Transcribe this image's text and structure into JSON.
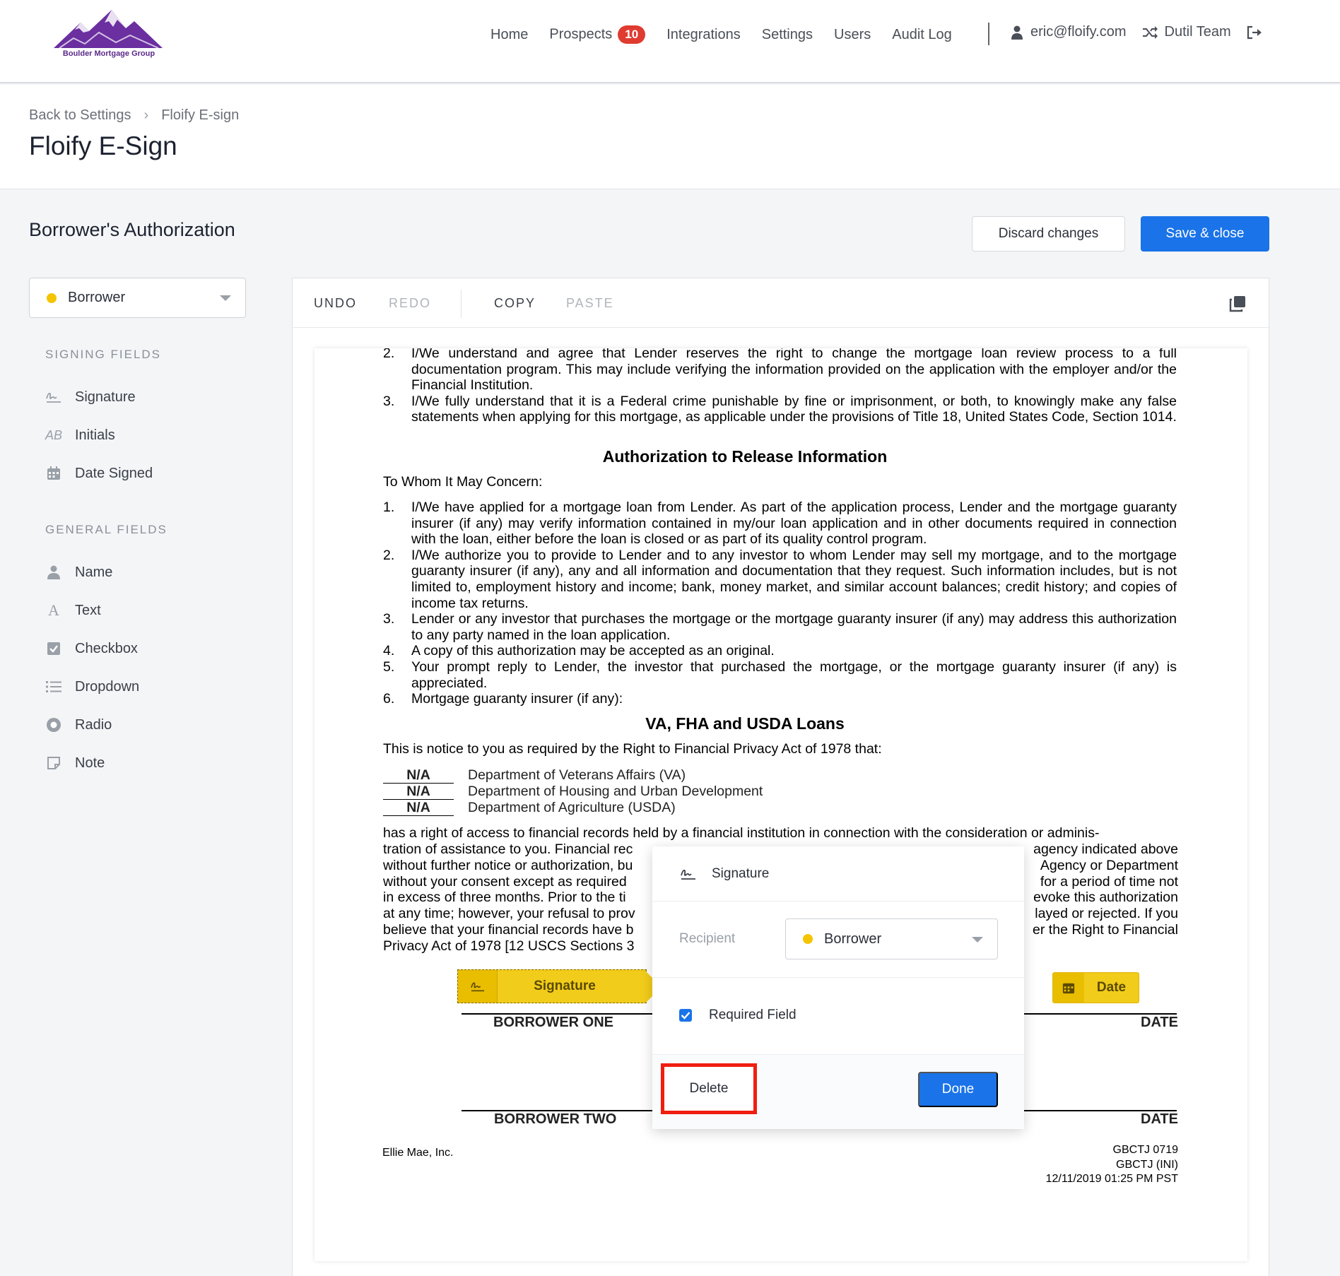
{
  "brand": {
    "logo_text": "Boulder Mortgage Group",
    "logo_color": "#6b2fa0"
  },
  "nav": {
    "home": "Home",
    "prospects": "Prospects",
    "prospects_badge": "10",
    "integrations": "Integrations",
    "settings": "Settings",
    "users": "Users",
    "audit_log": "Audit Log",
    "user_email": "eric@floify.com",
    "team": "Dutil Team"
  },
  "breadcrumb": {
    "back": "Back to Settings",
    "current": "Floify E-sign"
  },
  "page_title": "Floify E-Sign",
  "section": {
    "title": "Borrower's Authorization",
    "discard_label": "Discard changes",
    "save_label": "Save & close"
  },
  "left_panel": {
    "recipient": "Borrower",
    "recipient_color": "#f5c400",
    "signing_fields_label": "SIGNING FIELDS",
    "signing_fields": [
      "Signature",
      "Initials",
      "Date Signed"
    ],
    "general_fields_label": "GENERAL FIELDS",
    "general_fields": [
      "Name",
      "Text",
      "Checkbox",
      "Dropdown",
      "Radio",
      "Note"
    ]
  },
  "toolbar": {
    "undo": "UNDO",
    "redo": "REDO",
    "copy": "COPY",
    "paste": "PASTE"
  },
  "document": {
    "top_items": [
      {
        "num": "2.",
        "text": "I/We understand and agree that Lender reserves the right to change the mortgage loan review process to a full documentation program. This may include verifying the information provided on the application with the employer and/or the Financial Institution."
      },
      {
        "num": "3.",
        "text": "I/We fully understand that it is a Federal crime punishable by fine or imprisonment, or both, to knowingly make any false statements when applying for this mortgage, as applicable under the provisions of Title 18, United States Code, Section 1014."
      }
    ],
    "heading1": "Authorization to Release Information",
    "salutation": "To Whom It May Concern:",
    "items": [
      {
        "num": "1.",
        "text": "I/We have applied for a mortgage loan from Lender. As part of the application process, Lender and the mortgage guaranty insurer (if any) may verify information contained in my/our loan application and in other documents required in connection with the loan, either before the loan is closed or as part of its quality control program."
      },
      {
        "num": "2.",
        "text": "I/We authorize you to provide to Lender and to any investor to whom Lender may sell my mortgage, and to the mortgage guaranty insurer (if any), any and all information and documentation that they request. Such information includes, but is not limited to, employment history and income; bank, money market, and similar account balances; credit history; and copies of income tax returns."
      },
      {
        "num": "3.",
        "text": "Lender or any investor that purchases the mortgage or the mortgage guaranty insurer (if any) may address this authorization to any party named in the loan application."
      },
      {
        "num": "4.",
        "text": "A copy of this authorization may be accepted as an original."
      },
      {
        "num": "5.",
        "text": "Your prompt reply to Lender, the investor that purchased the mortgage, or the mortgage guaranty insurer (if any) is appreciated."
      },
      {
        "num": "6.",
        "text": "Mortgage guaranty insurer (if any):"
      }
    ],
    "heading2": "VA, FHA and USDA Loans",
    "notice": "This is notice to you as required by the Right to Financial Privacy Act of 1978 that:",
    "agencies": [
      {
        "mark": "N/A",
        "name": "Department of Veterans Affairs (VA)"
      },
      {
        "mark": "N/A",
        "name": "Department of Housing and Urban Development"
      },
      {
        "mark": "N/A",
        "name": "Department of Agriculture (USDA)"
      }
    ],
    "rights_lines": [
      {
        "left": "has a right of access to financial records held by a financial institution in connection with the consideration or adminis-",
        "right": ""
      },
      {
        "left": "tration of assistance to you. Financial rec",
        "right": "agency indicated above"
      },
      {
        "left": "without further notice or authorization, bu",
        "right": "Agency or Department"
      },
      {
        "left": "without your consent except as required",
        "right": "for a period of time not"
      },
      {
        "left": "in excess of three months. Prior to the ti",
        "right": "evoke this authorization"
      },
      {
        "left": "at any time; however, your refusal to prov",
        "right": "layed or rejected. If you"
      },
      {
        "left": "believe that your financial records have b",
        "right": "er the Right to Financial"
      },
      {
        "left": "Privacy Act of 1978 [12 USCS Sections 3",
        "right": ""
      }
    ],
    "borrower_one": "BORROWER ONE",
    "borrower_two": "BORROWER TWO",
    "date_label": "DATE",
    "footer_left": "Ellie Mae, Inc.",
    "footer_right": [
      "GBCTJ   0719",
      "GBCTJ (INI)",
      "12/11/2019 01:25 PM PST"
    ]
  },
  "tags": {
    "signature": "Signature",
    "date": "Date",
    "tag_color": "#f2cc1b"
  },
  "popover": {
    "title": "Signature",
    "recipient_label": "Recipient",
    "recipient_value": "Borrower",
    "required_label": "Required Field",
    "required_checked": true,
    "delete_label": "Delete",
    "done_label": "Done"
  }
}
